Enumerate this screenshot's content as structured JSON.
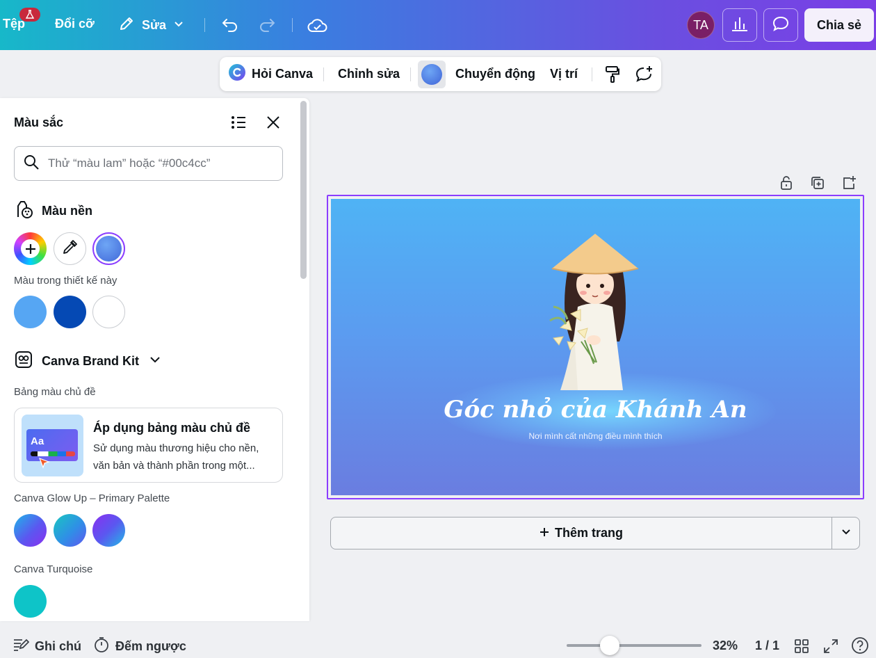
{
  "topbar": {
    "file_label": "Tệp",
    "resize_label": "Đổi cỡ",
    "edit_label": "Sửa",
    "avatar_initials": "TA",
    "share_label": "Chia sẻ"
  },
  "context_toolbar": {
    "ask_canva": "Hỏi Canva",
    "edit": "Chỉnh sửa",
    "current_color": "#5b8ff0",
    "animate": "Chuyển động",
    "position": "Vị trí"
  },
  "panel": {
    "title": "Màu sắc",
    "search_placeholder": "Thử “màu lam” hoặc “#00c4cc”",
    "background_section": "Màu nền",
    "in_design_label": "Màu trong thiết kế này",
    "in_design_colors": [
      "#56a6f3",
      "#0549b4",
      "#ffffff"
    ],
    "brand_kit_label": "Canva Brand Kit",
    "theme_palette_label": "Bảng màu chủ đề",
    "apply_card": {
      "thumb_text": "Aa",
      "title": "Áp dụng bảng màu chủ đề",
      "description": "Sử dụng màu thương hiệu cho nền, văn bản và thành phần trong một..."
    },
    "glow_up_label": "Canva Glow Up – Primary Palette",
    "turquoise_label": "Canva Turquoise",
    "turquoise_color": "#00c4cc"
  },
  "design": {
    "title": "Góc nhỏ của Khánh An",
    "subtitle": "Nơi mình cất những điều mình thích"
  },
  "add_page_label": "Thêm trang",
  "bottombar": {
    "notes_label": "Ghi chú",
    "timer_label": "Đếm ngược",
    "zoom_value": 32,
    "zoom_label": "32%",
    "pages_label": "1 / 1"
  }
}
